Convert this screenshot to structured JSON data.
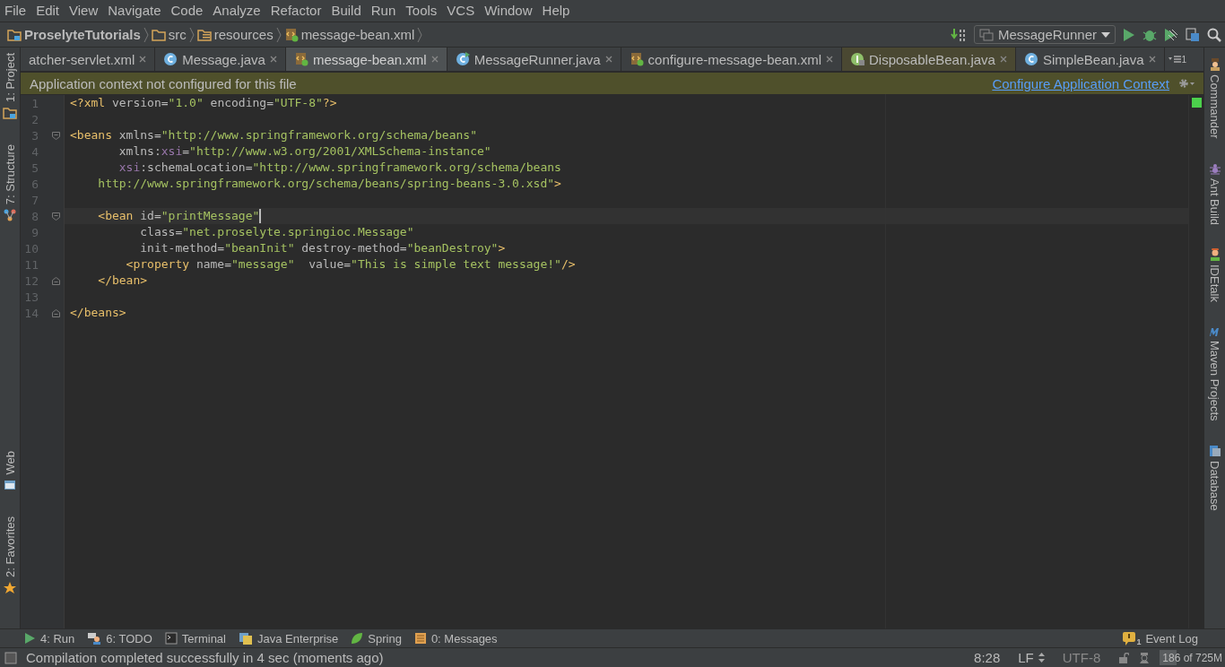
{
  "menu": [
    "File",
    "Edit",
    "View",
    "Navigate",
    "Code",
    "Analyze",
    "Refactor",
    "Build",
    "Run",
    "Tools",
    "VCS",
    "Window",
    "Help"
  ],
  "breadcrumbs": [
    {
      "label": "ProselyteTutorials",
      "kind": "project"
    },
    {
      "label": "src",
      "kind": "folder"
    },
    {
      "label": "resources",
      "kind": "resources"
    },
    {
      "label": "message-bean.xml",
      "kind": "xml"
    }
  ],
  "run_config": {
    "label": "MessageRunner"
  },
  "tabs": [
    {
      "label": "atcher-servlet.xml",
      "kind": "plain",
      "selected": false,
      "color": "#3c3f41"
    },
    {
      "label": "Message.java",
      "kind": "class",
      "selected": false,
      "color": "#3c3f41"
    },
    {
      "label": "message-bean.xml",
      "kind": "xml",
      "selected": true,
      "color": "#4e5254"
    },
    {
      "label": "MessageRunner.java",
      "kind": "class-run",
      "selected": false,
      "color": "#3c3f41"
    },
    {
      "label": "configure-message-bean.xml",
      "kind": "xml",
      "selected": false,
      "color": "#3c3f41"
    },
    {
      "label": "DisposableBean.java",
      "kind": "interface",
      "selected": false,
      "color": "#4a4832"
    },
    {
      "label": "SimpleBean.java",
      "kind": "class",
      "selected": false,
      "color": "#3c3f41"
    }
  ],
  "tab_overflow": {
    "count": "1"
  },
  "notification": {
    "text": "Application context not configured for this file",
    "link": "Configure Application Context"
  },
  "left_tools_top": [
    {
      "label": "1: Project",
      "kind": "project"
    },
    {
      "label": "7: Structure",
      "kind": "structure"
    }
  ],
  "left_tools_bottom": [
    {
      "label": "Web",
      "kind": "web"
    },
    {
      "label": "2: Favorites",
      "kind": "star"
    }
  ],
  "right_tools": [
    {
      "label": "Commander",
      "kind": "commander"
    },
    {
      "label": "Ant Build",
      "kind": "ant"
    },
    {
      "label": "IDEtalk",
      "kind": "person"
    },
    {
      "label": "Maven Projects",
      "kind": "maven"
    },
    {
      "label": "Database",
      "kind": "database"
    }
  ],
  "editor": {
    "lines": [
      {
        "number": "1",
        "current": false,
        "kind": "plain",
        "tokens": [
          {
            "kind": "tag",
            "text": "<?xml"
          },
          {
            "kind": "attr",
            "text": " version="
          },
          {
            "kind": "value",
            "text": "\"1.0\""
          },
          {
            "kind": "attr",
            "text": " encoding="
          },
          {
            "kind": "value",
            "text": "\"UTF-8\""
          },
          {
            "kind": "tag",
            "text": "?>"
          }
        ]
      },
      {
        "number": "2",
        "current": false,
        "kind": "plain"
      },
      {
        "number": "3",
        "current": false,
        "kind": "fold-start",
        "tokens": [
          {
            "kind": "tag",
            "text": "<beans"
          },
          {
            "kind": "attr",
            "text": " xmlns="
          },
          {
            "kind": "value",
            "text": "\"http://www.springframework.org/schema/beans\""
          }
        ]
      },
      {
        "number": "4",
        "current": false,
        "kind": "plain",
        "tokens": [
          {
            "kind": "attr",
            "text": "       xmlns:"
          },
          {
            "kind": "ns",
            "text": "xsi"
          },
          {
            "kind": "attr",
            "text": "="
          },
          {
            "kind": "value",
            "text": "\"http://www.w3.org/2001/XMLSchema-instance\""
          }
        ]
      },
      {
        "number": "5",
        "current": false,
        "kind": "plain",
        "tokens": [
          {
            "kind": "ns",
            "text": "       xsi"
          },
          {
            "kind": "attr",
            "text": ":schemaLocation="
          },
          {
            "kind": "value",
            "text": "\"http://www.springframework.org/schema/beans"
          }
        ]
      },
      {
        "number": "6",
        "current": false,
        "kind": "plain",
        "tokens": [
          {
            "kind": "value",
            "text": "    http://www.springframework.org/schema/beans/spring-beans-3.0.xsd\""
          },
          {
            "kind": "tag",
            "text": ">"
          }
        ]
      },
      {
        "number": "7",
        "current": false,
        "kind": "plain"
      },
      {
        "number": "8",
        "current": true,
        "kind": "fold-start",
        "tokens": [
          {
            "kind": "tag",
            "text": "    <bean"
          },
          {
            "kind": "attr",
            "text": " id="
          },
          {
            "kind": "value",
            "text": "\"printMessage\""
          }
        ]
      },
      {
        "number": "9",
        "current": false,
        "kind": "plain",
        "tokens": [
          {
            "kind": "attr",
            "text": "          class="
          },
          {
            "kind": "value",
            "text": "\"net.proselyte.springioc.Message\""
          }
        ]
      },
      {
        "number": "10",
        "current": false,
        "kind": "plain",
        "tokens": [
          {
            "kind": "attr",
            "text": "          init-method="
          },
          {
            "kind": "value",
            "text": "\"beanInit\""
          },
          {
            "kind": "attr",
            "text": " destroy-method="
          },
          {
            "kind": "value",
            "text": "\"beanDestroy\""
          },
          {
            "kind": "tag",
            "text": ">"
          }
        ]
      },
      {
        "number": "11",
        "current": false,
        "kind": "plain",
        "tokens": [
          {
            "kind": "tag",
            "text": "        <property"
          },
          {
            "kind": "attr",
            "text": " name="
          },
          {
            "kind": "value",
            "text": "\"message\""
          },
          {
            "kind": "attr",
            "text": "  value="
          },
          {
            "kind": "value",
            "text": "\"This is simple text message!\""
          },
          {
            "kind": "tag",
            "text": "/>"
          }
        ]
      },
      {
        "number": "12",
        "current": false,
        "kind": "fold-end",
        "tokens": [
          {
            "kind": "tag",
            "text": "    </bean>"
          }
        ]
      },
      {
        "number": "13",
        "current": false,
        "kind": "plain"
      },
      {
        "number": "14",
        "current": false,
        "kind": "fold-end",
        "tokens": [
          {
            "kind": "tag",
            "text": "</beans>"
          }
        ]
      }
    ]
  },
  "bottom_tools": [
    {
      "label": "4: Run",
      "kind": "run"
    },
    {
      "label": "6: TODO",
      "kind": "todo"
    },
    {
      "label": "Terminal",
      "kind": "terminal"
    },
    {
      "label": "Java Enterprise",
      "kind": "javaee"
    },
    {
      "label": "Spring",
      "kind": "spring"
    },
    {
      "label": "0: Messages",
      "kind": "messages"
    }
  ],
  "event_log": {
    "label": "Event Log",
    "count": "1"
  },
  "status": {
    "message": "Compilation completed successfully in 4 sec (moments ago)",
    "position": "8:28",
    "line_separator": "LF",
    "encoding": "UTF-8",
    "memory": {
      "text": "186 of 725M",
      "level": 0.26
    }
  }
}
